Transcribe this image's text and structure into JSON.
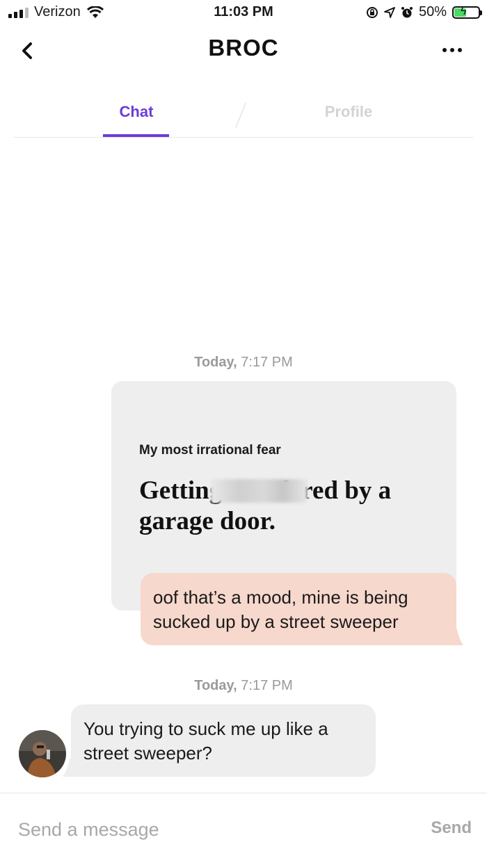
{
  "status_bar": {
    "carrier": "Verizon",
    "time": "11:03 PM",
    "battery": "50%",
    "battery_level": 0.5,
    "icons": [
      "signal-icon",
      "wifi-icon",
      "screen-lock-icon",
      "location-icon",
      "alarm-icon",
      "battery-charging-icon"
    ]
  },
  "header": {
    "title": "BROC",
    "back_icon": "chevron-left-icon",
    "more_icon": "more-dots-icon"
  },
  "tabs": [
    {
      "label": "Chat",
      "active": true
    },
    {
      "label": "Profile",
      "active": false
    }
  ],
  "colors": {
    "accent": "#6a3dd9",
    "outgoing_bubble": "#f7d8cc",
    "incoming_bubble": "#eeeeee",
    "muted_text": "#a8a8a8"
  },
  "messages": [
    {
      "timestamp_day": "Today,",
      "timestamp_time": "7:17 PM",
      "prompt_card": {
        "prompt": "My most irrational fear",
        "answer": "Getting murdered by a garage door."
      },
      "reply_text": "oof that’s a mood, mine is being sucked up by a street sweeper"
    },
    {
      "timestamp_day": "Today,",
      "timestamp_time": "7:17 PM",
      "text": "You trying to suck me up like a street sweeper?"
    }
  ],
  "composer": {
    "placeholder": "Send a message",
    "send_label": "Send"
  }
}
